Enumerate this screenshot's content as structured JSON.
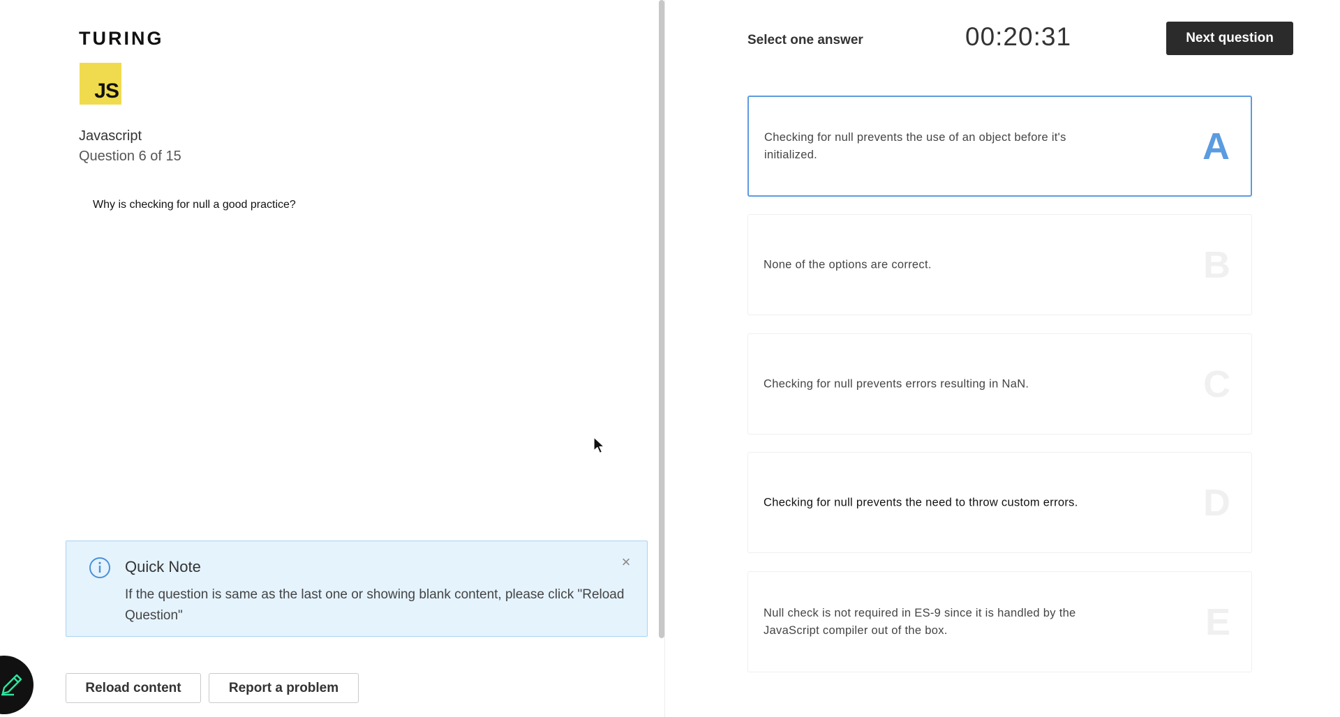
{
  "brand": {
    "logo_text": "TURING",
    "badge_text": "JS"
  },
  "question": {
    "subject": "Javascript",
    "counter": "Question 6 of 15",
    "text": "Why is checking for null a good practice?"
  },
  "note": {
    "title": "Quick Note",
    "body": "If the question is same as the last one or showing blank content, please click \"Reload Question\"",
    "close_glyph": "×"
  },
  "actions": {
    "reload_label": "Reload content",
    "report_label": "Report a problem"
  },
  "header": {
    "instruction": "Select one answer",
    "timer": "00:20:31",
    "next_label": "Next question"
  },
  "options": [
    {
      "letter": "A",
      "text": "Checking for null prevents the use of an object before it's initialized.",
      "selected": true
    },
    {
      "letter": "B",
      "text": "None of the options are correct.",
      "selected": false
    },
    {
      "letter": "C",
      "text": "Checking for null prevents errors resulting in NaN.",
      "selected": false
    },
    {
      "letter": "D",
      "text": "Checking for null prevents the need to throw custom errors.",
      "selected": false
    },
    {
      "letter": "E",
      "text": "Null check is not required in ES-9 since it is handled by the JavaScript compiler out of the box.",
      "selected": false
    }
  ],
  "colors": {
    "accent": "#5b9be0",
    "badge_yellow": "#f0db4f",
    "note_bg": "#e5f3fd",
    "primary_button": "#2b2b2b"
  },
  "icons": {
    "note": "info-icon",
    "close": "close-icon",
    "fab": "pencil-icon",
    "cursor": "mouse-cursor-icon"
  }
}
